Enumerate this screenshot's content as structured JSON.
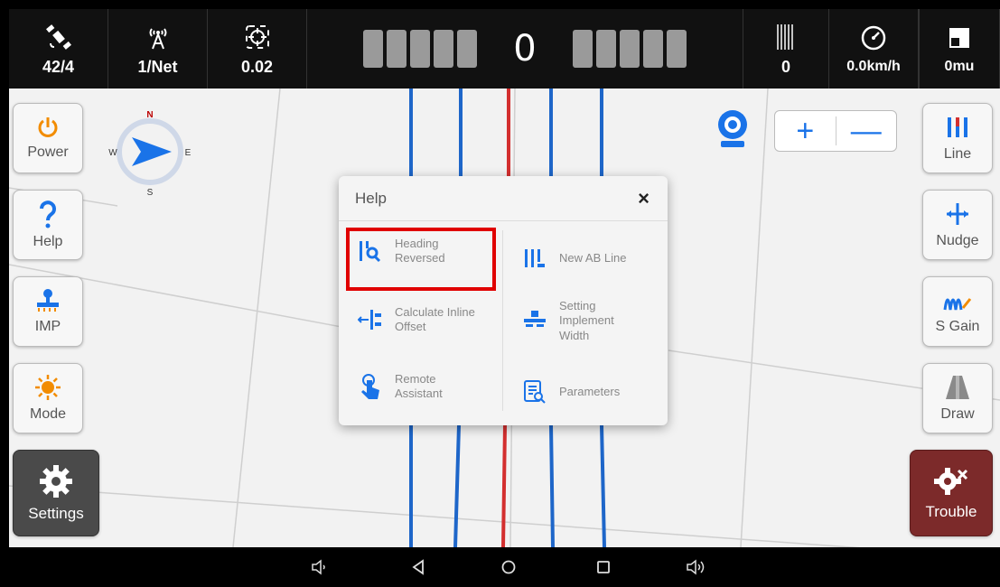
{
  "topbar": {
    "satellites": "42/4",
    "network": "1/Net",
    "accuracy": "0.02",
    "deviation": "0",
    "rows": "0",
    "speed": "0.0km/h",
    "area": "0mu"
  },
  "left_buttons": [
    {
      "label": "Power",
      "icon": "power-icon"
    },
    {
      "label": "Help",
      "icon": "help-icon"
    },
    {
      "label": "IMP",
      "icon": "implement-icon"
    },
    {
      "label": "Mode",
      "icon": "sun-icon"
    },
    {
      "label": "Settings",
      "icon": "gear-icon"
    }
  ],
  "right_buttons": [
    {
      "label": "Line",
      "icon": "line-icon"
    },
    {
      "label": "Nudge",
      "icon": "nudge-icon"
    },
    {
      "label": "S Gain",
      "icon": "gain-icon"
    },
    {
      "label": "Draw",
      "icon": "draw-icon"
    },
    {
      "label": "Trouble",
      "icon": "trouble-icon"
    }
  ],
  "compass": {
    "n": "N",
    "e": "E",
    "s": "S",
    "w": "W"
  },
  "zoom": {
    "plus": "+",
    "minus": "—"
  },
  "dialog": {
    "title": "Help",
    "close": "×",
    "items": [
      {
        "label": "Heading Reversed",
        "icon": "heading-reversed-icon"
      },
      {
        "label": "New AB Line",
        "icon": "ab-line-icon"
      },
      {
        "label": "Calculate Inline Offset",
        "icon": "inline-offset-icon"
      },
      {
        "label": "Setting Implement Width",
        "icon": "implement-width-icon"
      },
      {
        "label": "Remote Assistant",
        "icon": "remote-assistant-icon"
      },
      {
        "label": "Parameters",
        "icon": "parameters-icon"
      }
    ]
  },
  "colors": {
    "accent": "#1a73e8",
    "guide_line": "#1565c0",
    "active_line": "#d32f2f",
    "highlight": "#e00000",
    "trouble": "#7c2a2a"
  }
}
